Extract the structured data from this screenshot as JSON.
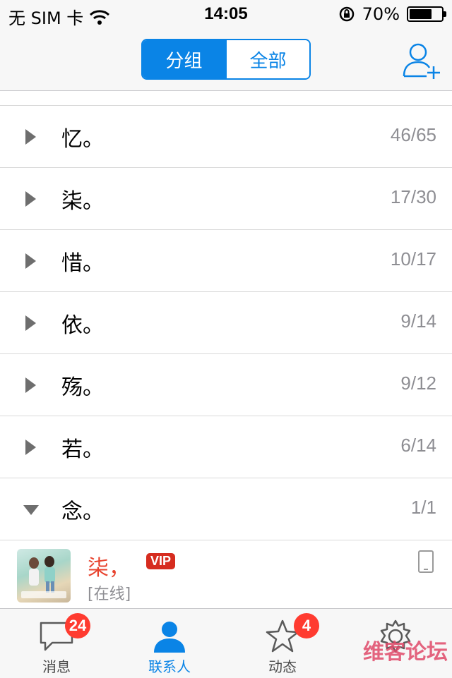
{
  "status_bar": {
    "carrier": "无 SIM 卡",
    "time": "14:05",
    "battery_text": "70%",
    "battery_level": 0.7
  },
  "nav": {
    "segments": [
      "分组",
      "全部"
    ],
    "active_segment": 0,
    "add_icon": "add-friend-icon"
  },
  "groups": [
    {
      "name": "忆。",
      "count": "46/65",
      "expanded": false
    },
    {
      "name": "柒。",
      "count": "17/30",
      "expanded": false
    },
    {
      "name": "惜。",
      "count": "10/17",
      "expanded": false
    },
    {
      "name": "依。",
      "count": "9/14",
      "expanded": false
    },
    {
      "name": "殇。",
      "count": "9/12",
      "expanded": false
    },
    {
      "name": "若。",
      "count": "6/14",
      "expanded": false
    },
    {
      "name": "念。",
      "count": "1/1",
      "expanded": true
    }
  ],
  "friend": {
    "name": "柒，",
    "badge": "VIP",
    "status": "[在线]",
    "device_icon": "phone-icon"
  },
  "tabs": [
    {
      "label": "消息",
      "icon": "chat-bubble-icon",
      "badge": "24"
    },
    {
      "label": "联系人",
      "icon": "contacts-icon",
      "badge": ""
    },
    {
      "label": "动态",
      "icon": "star-icon",
      "badge": "4"
    },
    {
      "label": "",
      "icon": "gear-icon",
      "badge": ""
    }
  ],
  "active_tab": 1,
  "watermark": "维客论坛",
  "colors": {
    "accent": "#0a84e6",
    "badge": "#ff3b30",
    "friend_name": "#e8432e",
    "vip": "#d62c1f"
  }
}
